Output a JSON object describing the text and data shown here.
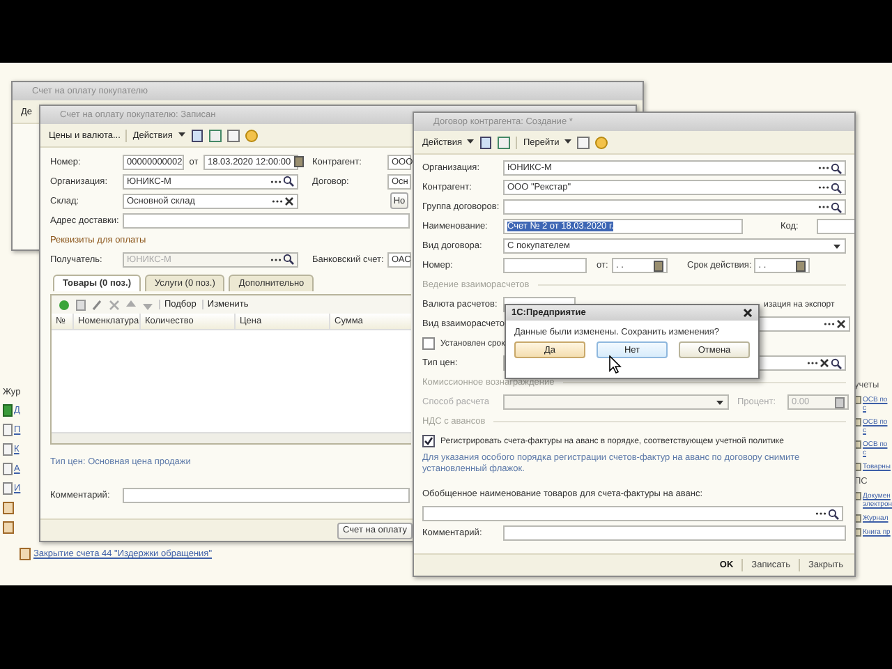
{
  "desktop": {
    "back_window": {
      "title": "Счет на оплату покупателю",
      "toolbar_text": "Де"
    },
    "journal": {
      "heading": "Жур",
      "items": [
        "Д",
        "П",
        "К",
        "А",
        "И"
      ]
    },
    "bottom_link": "Закрытие счета 44 \"Издержки обращения\"",
    "reports_panel": [
      {
        "kind": "heading",
        "text": "учеты"
      },
      {
        "kind": "link",
        "text": "ОСВ по с"
      },
      {
        "kind": "link",
        "text": "ОСВ по с"
      },
      {
        "kind": "link",
        "text": "ОСВ по с"
      },
      {
        "kind": "link",
        "text": "Товарны"
      },
      {
        "kind": "heading",
        "text": "ПС"
      },
      {
        "kind": "link",
        "text": "Докумен электрон"
      },
      {
        "kind": "link",
        "text": "Журнал"
      },
      {
        "kind": "link",
        "text": "Книга пр"
      }
    ]
  },
  "invoice_window": {
    "title": "Счет на оплату покупателю: Записан",
    "toolbar": {
      "prices": "Цены и валюта...",
      "actions": "Действия"
    },
    "number": {
      "label": "Номер:",
      "value": "00000000002"
    },
    "date": {
      "label": "от",
      "value": "18.03.2020 12:00:00"
    },
    "counterparty": {
      "label": "Контрагент:",
      "value": "ООО"
    },
    "organization": {
      "label": "Организация:",
      "value": "ЮНИКС-М"
    },
    "contract": {
      "label": "Договор:",
      "value": "Осн"
    },
    "warehouse": {
      "label": "Склад:",
      "value": "Основной склад"
    },
    "side_button": "Но",
    "address": {
      "label": "Адрес доставки:"
    },
    "payment_section": "Реквизиты для оплаты",
    "recipient": {
      "label": "Получатель:",
      "value": "ЮНИКС-М",
      "disabled": true
    },
    "bank_account": {
      "label": "Банковский счет:",
      "value": "ОАС"
    },
    "tabs": [
      {
        "label": "Товары (0 поз.)",
        "selected": true
      },
      {
        "label": "Услуги (0 поз.)",
        "selected": false
      },
      {
        "label": "Дополнительно",
        "selected": false
      }
    ],
    "table_actions": [
      "Подбор",
      "Изменить"
    ],
    "columns": [
      "№",
      "Номенклатура",
      "Количество",
      "Цена",
      "Сумма"
    ],
    "price_type_link": "Тип цен: Основная цена продажи",
    "comment": {
      "label": "Комментарий:"
    },
    "footer_button": "Счет на оплату"
  },
  "contract_window": {
    "title": "Договор контрагента: Создание *",
    "toolbar": {
      "actions": "Действия",
      "goto": "Перейти"
    },
    "rows": [
      {
        "kind": "lookup",
        "label": "Организация:",
        "value": "ЮНИКС-М"
      },
      {
        "kind": "lookup",
        "label": "Контрагент:",
        "value": "ООО \"Рекстар\""
      },
      {
        "kind": "lookup",
        "label": "Группа договоров:"
      },
      {
        "kind": "name",
        "label": "Наименование:",
        "value": "Счет № 2 от 18.03.2020 г.",
        "highlighted": true,
        "code_label": "Код:"
      },
      {
        "kind": "dropdown",
        "label": "Вид договора:",
        "value": "С покупателем"
      },
      {
        "kind": "number",
        "label": "Номер:",
        "date_label": "от:",
        "date_value": ". .",
        "term_label": "Срок действия:",
        "term_value": ". ."
      },
      {
        "kind": "section",
        "text": "Ведение взаиморасчетов"
      },
      {
        "kind": "currency",
        "label": "Валюта расчетов:",
        "export_label": "изация на экспорт"
      },
      {
        "kind": "choice",
        "label": "Вид взаиморасчето"
      },
      {
        "kind": "checkbox",
        "label": "Установлен срок",
        "checked": false
      },
      {
        "kind": "lookup_clear",
        "label": "Тип цен:"
      },
      {
        "kind": "section",
        "text": "Комиссионное вознаграждение"
      },
      {
        "kind": "payment",
        "label": "Способ расчета",
        "disabled": true,
        "percent_label": "Процент:",
        "percent_value": "0.00"
      },
      {
        "kind": "section",
        "text": "НДС с авансов"
      },
      {
        "kind": "checkbox",
        "label": "Регистрировать счета-фактуры на аванс в порядке, соответствующем учетной политике",
        "checked": true
      },
      {
        "kind": "note",
        "text": "Для указания особого порядка регистрации счетов-фактур на аванс по договору снимите установленный флажок."
      },
      {
        "kind": "caption",
        "text": "Обобщенное наименование товаров для счета-фактуры на аванс:"
      },
      {
        "kind": "wide_field"
      },
      {
        "kind": "plain",
        "label": "Комментарий:"
      }
    ],
    "footer": [
      {
        "label": "OK",
        "default": true
      },
      {
        "label": "Записать",
        "default": false
      },
      {
        "label": "Закрыть",
        "default": false
      }
    ]
  },
  "dialog": {
    "title": "1С:Предприятие",
    "message": "Данные были изменены. Сохранить изменения?",
    "buttons": [
      {
        "label": "Да",
        "default": true,
        "hovered": false
      },
      {
        "label": "Нет",
        "default": false,
        "hovered": true
      },
      {
        "label": "Отмена",
        "default": false,
        "hovered": false
      }
    ]
  }
}
